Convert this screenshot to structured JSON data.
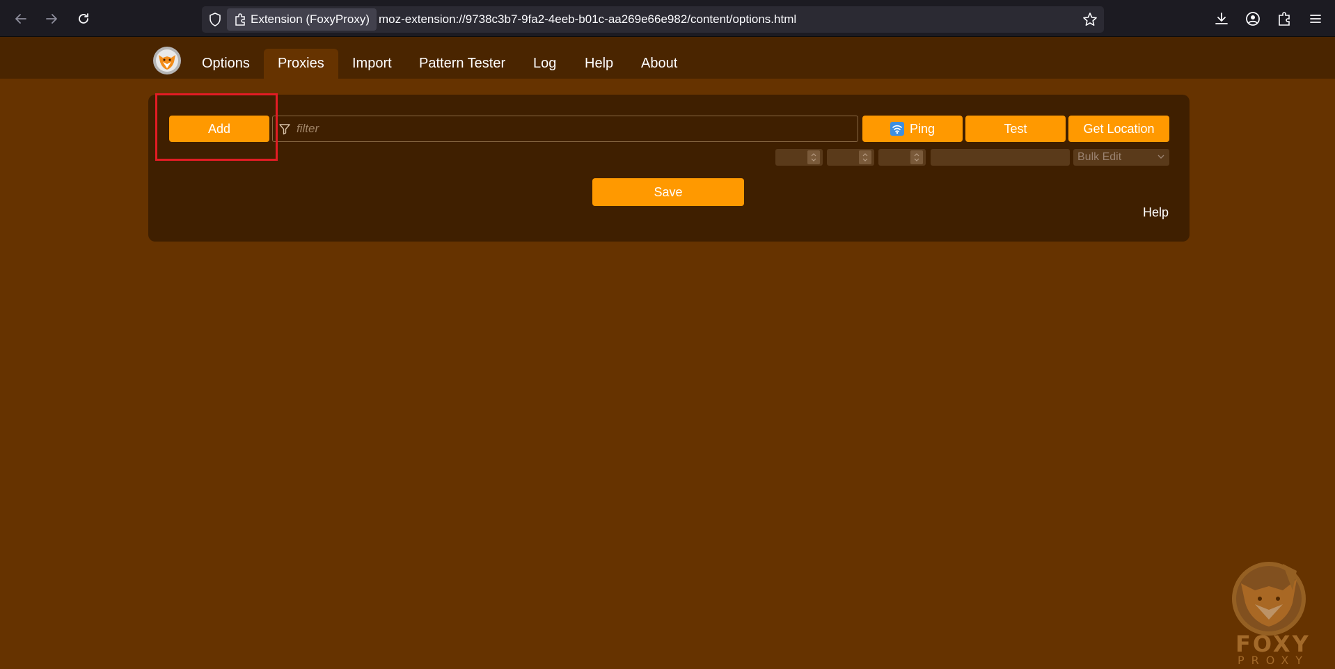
{
  "browser": {
    "extension_chip": "Extension (FoxyProxy)",
    "url": "moz-extension://9738c3b7-9fa2-4eeb-b01c-aa269e66e982/content/options.html"
  },
  "nav": {
    "tabs": [
      {
        "label": "Options",
        "active": false
      },
      {
        "label": "Proxies",
        "active": true
      },
      {
        "label": "Import",
        "active": false
      },
      {
        "label": "Pattern Tester",
        "active": false
      },
      {
        "label": "Log",
        "active": false
      },
      {
        "label": "Help",
        "active": false
      },
      {
        "label": "About",
        "active": false
      }
    ]
  },
  "toolbar": {
    "add_label": "Add",
    "filter_placeholder": "filter",
    "ping_label": "Ping",
    "test_label": "Test",
    "get_location_label": "Get Location",
    "bulk_edit_label": "Bulk Edit",
    "save_label": "Save",
    "help_label": "Help"
  },
  "watermark": {
    "line1": "FOXY",
    "line2": "PROXY"
  },
  "colors": {
    "page_bg": "#663300",
    "nav_bg": "#4a2500",
    "panel_bg": "#3f1f00",
    "button": "#ff9900",
    "highlight": "#e31c24"
  }
}
